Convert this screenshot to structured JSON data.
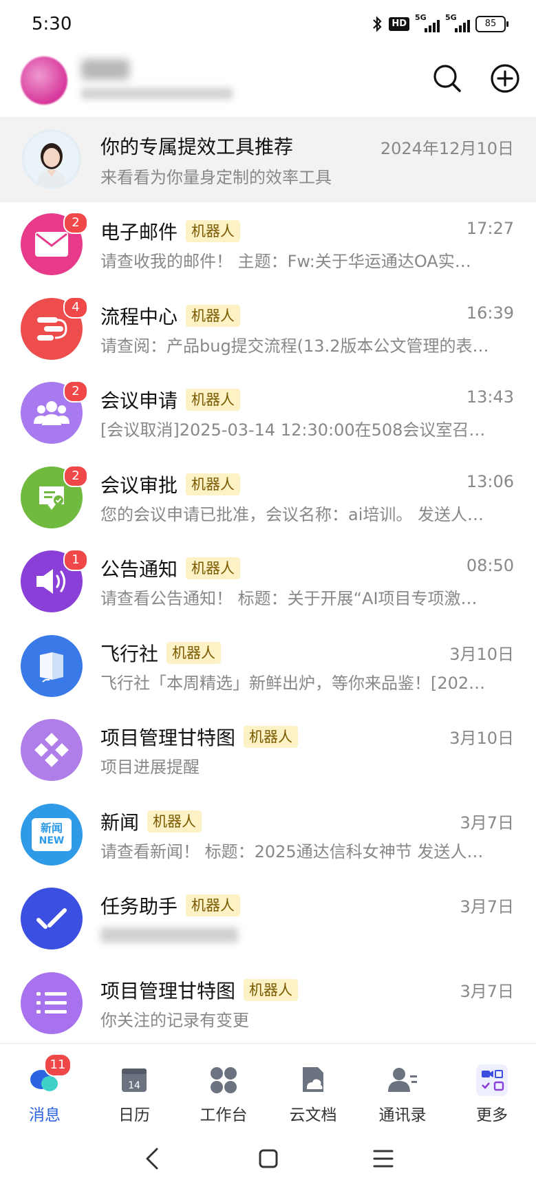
{
  "status_bar": {
    "time": "5:30",
    "network_label": "HD",
    "signal1": "5G",
    "signal2": "5G",
    "battery": "85"
  },
  "header": {
    "search_icon": "search-icon",
    "add_icon": "plus-circle-icon"
  },
  "pinned": {
    "title": "你的专属提效工具推荐",
    "subtitle": "来看看为你量身定制的效率工具",
    "time": "2024年12月10日"
  },
  "robot_tag": "机器人",
  "conversations": [
    {
      "title": "电子邮件",
      "robot": true,
      "badge": "2",
      "time": "17:27",
      "preview": "请查收我的邮件！ 主题：Fw:关于华运通达OA实…",
      "color": "#e83a8a",
      "icon": "mail-icon"
    },
    {
      "title": "流程中心",
      "robot": true,
      "badge": "4",
      "time": "16:39",
      "preview": "请查阅：产品bug提交流程(13.2版本公文管理的表…",
      "color": "#ee4d4d",
      "icon": "flow-icon"
    },
    {
      "title": "会议申请",
      "robot": true,
      "badge": "2",
      "time": "13:43",
      "preview": "[会议取消]2025-03-14 12:30:00在508会议室召…",
      "color": "#a77af0",
      "icon": "people-icon"
    },
    {
      "title": "会议审批",
      "robot": true,
      "badge": "2",
      "time": "13:06",
      "preview": "您的会议申请已批准，会议名称：ai培训。 发送人…",
      "color": "#6fba3f",
      "icon": "approval-icon"
    },
    {
      "title": "公告通知",
      "robot": true,
      "badge": "1",
      "time": "08:50",
      "preview": "请查看公告通知！ 标题：关于开展“AI项目专项激…",
      "color": "#8a3fd8",
      "icon": "speaker-icon"
    },
    {
      "title": "飞行社",
      "robot": true,
      "badge": "",
      "time": "3月10日",
      "preview": "飞行社「本周精选」新鲜出炉，等你来品鉴！[202…",
      "color": "#3a7ae8",
      "icon": "book-icon"
    },
    {
      "title": "项目管理甘特图",
      "robot": true,
      "badge": "",
      "time": "3月10日",
      "preview": "项目进展提醒",
      "color": "#b07ee8",
      "icon": "diamond-grid-icon"
    },
    {
      "title": "新闻",
      "robot": true,
      "badge": "",
      "time": "3月7日",
      "preview": "请查看新闻！ 标题：2025通达信科女神节 发送人…",
      "color": "#2f9be8",
      "icon": "news-icon",
      "icon_text1": "新闻",
      "icon_text2": "NEW"
    },
    {
      "title": "任务助手",
      "robot": true,
      "badge": "",
      "time": "3月7日",
      "preview": "",
      "color": "#3b4fe0",
      "icon": "check-icon"
    },
    {
      "title": "项目管理甘特图",
      "robot": true,
      "badge": "",
      "time": "3月7日",
      "preview": "你关注的记录有变更",
      "color": "#a872ee",
      "icon": "list-icon"
    }
  ],
  "bottom_nav": [
    {
      "label": "消息",
      "icon": "chat-bubbles-icon",
      "badge": "11",
      "active": true
    },
    {
      "label": "日历",
      "icon": "calendar-icon",
      "badge": "",
      "calendar_day": "14"
    },
    {
      "label": "工作台",
      "icon": "apps-grid-icon",
      "badge": ""
    },
    {
      "label": "云文档",
      "icon": "cloud-doc-icon",
      "badge": ""
    },
    {
      "label": "通讯录",
      "icon": "contacts-icon",
      "badge": ""
    },
    {
      "label": "更多",
      "icon": "more-apps-icon",
      "badge": ""
    }
  ],
  "system_nav": {
    "back": "back-icon",
    "home": "home-icon",
    "menu": "menu-icon"
  }
}
